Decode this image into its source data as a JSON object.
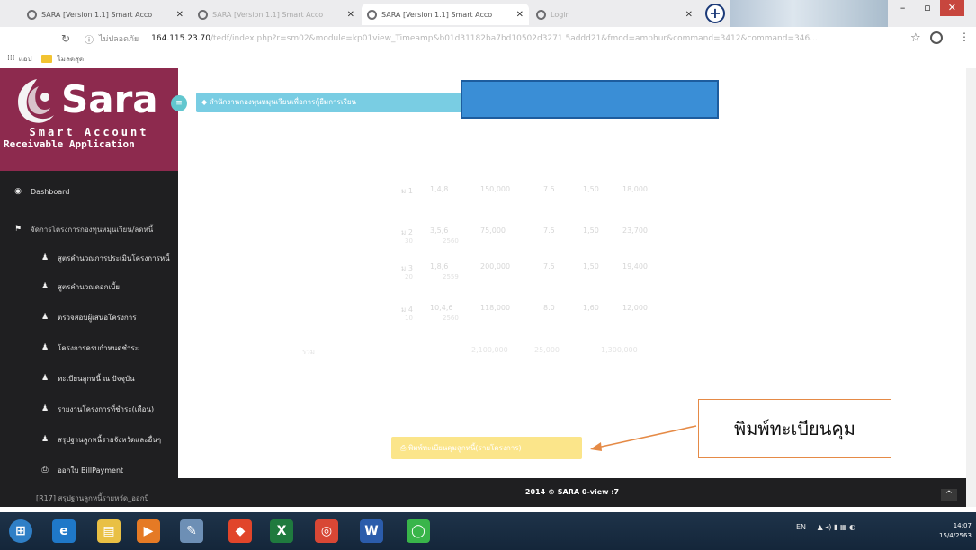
{
  "browser": {
    "tabs": [
      {
        "title": "SARA [Version 1.1] Smart Acco",
        "active": false
      },
      {
        "title": "SARA [Version 1.1] Smart Acco",
        "active": false
      },
      {
        "title": "SARA [Version 1.1] Smart Acco",
        "active": true
      },
      {
        "title": "Login",
        "active": false
      }
    ],
    "new_tab_label": "+",
    "window_buttons": {
      "minimize": "–",
      "maximize": "▫",
      "close": "✕"
    },
    "address": {
      "security_label": "ไม่ปลอดภัย",
      "host": "164.115.23.70",
      "path": "/tedf/index.php?r=sm02&module=kp01view_Timeamp&b01d31182ba7bd10502d3271 5addd21&fmod=amphur&command=3412&command=346..."
    },
    "bookmarks": {
      "apps_label": "แอป",
      "folder_label": "ไมลดสุด"
    }
  },
  "sidebar": {
    "brand": {
      "name": "Sara",
      "line1": "Smart Account",
      "line2": "Receivable Application"
    },
    "menu": [
      {
        "label": "Dashboard",
        "icon": "dashboard-icon",
        "glyph": "◉",
        "kind": "top"
      },
      {
        "label": "จัดการโครงการกองทุนหมุนเวียน/ลดหนี้",
        "icon": "flag-icon",
        "glyph": "⚑",
        "kind": "group"
      },
      {
        "label": "สูตรคำนวณการประเมินโครงการหนี้",
        "icon": "user-icon",
        "glyph": "♟",
        "kind": "sub"
      },
      {
        "label": "สูตรคำนวณดอกเบี้ย",
        "icon": "user-icon",
        "glyph": "♟",
        "kind": "sub"
      },
      {
        "label": "ตรวจสอบผู้เสนอโครงการ",
        "icon": "user-icon",
        "glyph": "♟",
        "kind": "sub"
      },
      {
        "label": "โครงการครบกำหนดชำระ",
        "icon": "user-icon",
        "glyph": "♟",
        "kind": "sub"
      },
      {
        "label": "ทะเบียนลูกหนี้ ณ ปัจจุบัน",
        "icon": "user-icon",
        "glyph": "♟",
        "kind": "sub"
      },
      {
        "label": "รายงานโครงการที่ชำระ(เดือน)",
        "icon": "user-icon",
        "glyph": "♟",
        "kind": "sub"
      },
      {
        "label": "สรุปฐานลูกหนี้รายจังหวัดและอื่นๆ",
        "icon": "user-icon",
        "glyph": "♟",
        "kind": "sub"
      },
      {
        "label": "ออกใบ BillPayment",
        "icon": "printer-icon",
        "glyph": "⎙",
        "kind": "sub"
      },
      {
        "label": "[R17] สรุปฐานลูกหนี้รายหวัด_ออกบี",
        "icon": "",
        "glyph": "",
        "kind": "last"
      }
    ]
  },
  "main": {
    "banner_label": "◆ สำนักงานกองทุนหมุนเวียนเพื่อการกู้ยืมการเรียน",
    "table_rows": [
      {
        "cols": [
          "ม.1",
          "1,4,8",
          "150,000",
          "7.5",
          "1,50",
          "18,000"
        ],
        "sub": [
          "",
          "",
          "",
          "",
          "",
          ""
        ]
      },
      {
        "cols": [
          "ม.2",
          "3,5,6",
          "75,000",
          "7.5",
          "1,50",
          "23,700"
        ],
        "sub": [
          "30",
          "2560",
          "",
          "",
          "",
          ""
        ]
      },
      {
        "cols": [
          "ม.3",
          "1,8,6",
          "200,000",
          "7.5",
          "1,50",
          "19,400"
        ],
        "sub": [
          "20",
          "2559",
          "",
          "",
          "",
          ""
        ]
      },
      {
        "cols": [
          "ม.4",
          "10,4,6",
          "118,000",
          "8.0",
          "1,60",
          "12,000"
        ],
        "sub": [
          "10",
          "2560",
          "",
          "",
          "",
          ""
        ]
      }
    ],
    "total_row": [
      "รวม",
      "2,100,000",
      "25,000",
      "1,300,000"
    ],
    "print_button_label": "⎙ พิมพ์ทะเบียนคุมลูกหนี้(รายโครงการ)",
    "callout_text": "พิมพ์ทะเบียนคุม",
    "footer_text": "2014 © SARA 0-view :7",
    "scroll_top_label": "^"
  },
  "taskbar": {
    "apps": [
      {
        "icon": "windows-start-icon",
        "glyph": "⊞",
        "color": "#2f7fc6"
      },
      {
        "icon": "internet-explorer-icon",
        "glyph": "e",
        "color": "#1f78c8"
      },
      {
        "icon": "file-explorer-icon",
        "glyph": "▤",
        "color": "#e9c044"
      },
      {
        "icon": "media-player-icon",
        "glyph": "▶",
        "color": "#e57a25"
      },
      {
        "icon": "paint-icon",
        "glyph": "✎",
        "color": "#6d8fb5"
      },
      {
        "icon": "brave-browser-icon",
        "glyph": "◆",
        "color": "#e1452a"
      },
      {
        "icon": "excel-icon",
        "glyph": "X",
        "color": "#1f7a3e"
      },
      {
        "icon": "chrome-icon",
        "glyph": "◎",
        "color": "#d84735"
      },
      {
        "icon": "word-icon",
        "glyph": "W",
        "color": "#2b5cab"
      },
      {
        "icon": "line-icon",
        "glyph": "◯",
        "color": "#39b54a"
      }
    ],
    "tray_label": "EN",
    "time": "14:07",
    "date": "15/4/2563"
  }
}
